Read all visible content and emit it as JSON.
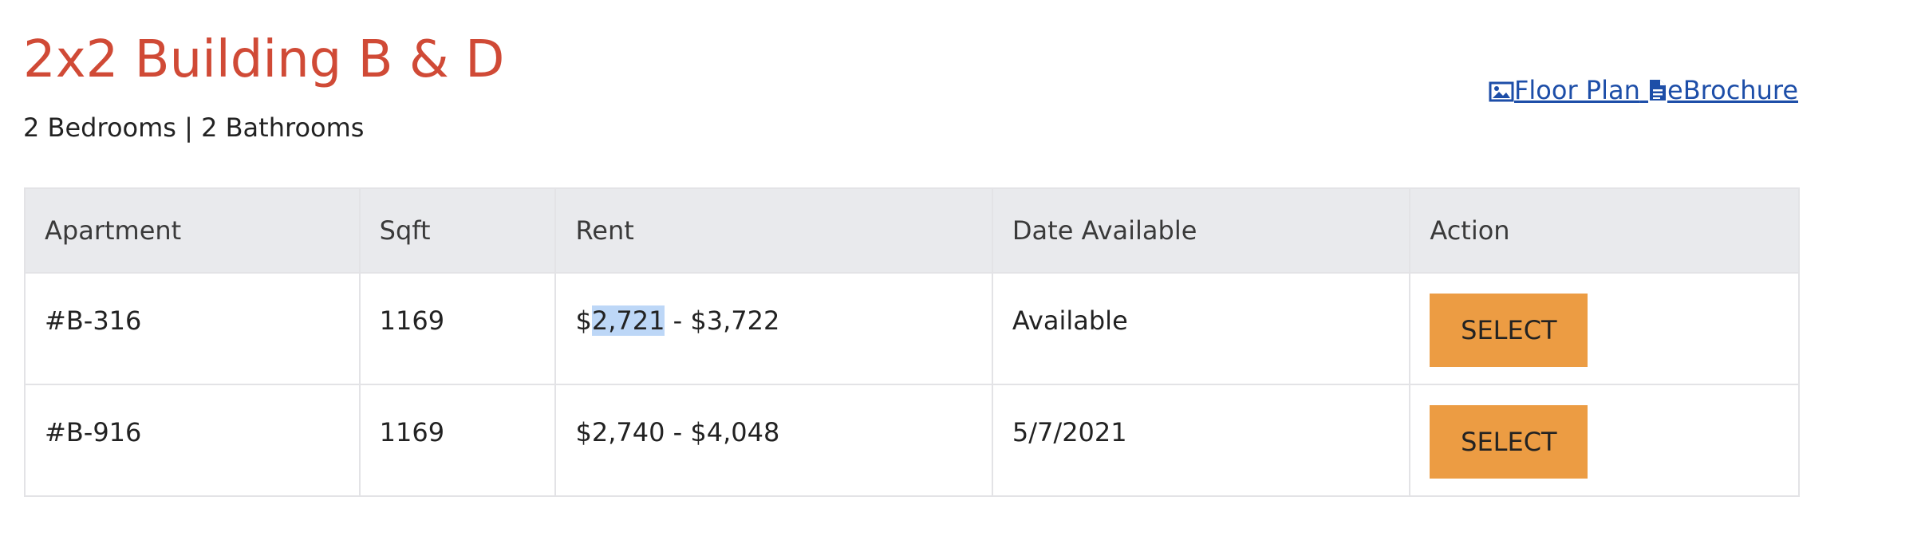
{
  "plan": {
    "title": "2x2 Building B & D",
    "details": "2 Bedrooms | 2 Bathrooms"
  },
  "links": {
    "floor_plan": "Floor Plan",
    "floor_plan_icon": "image-icon",
    "ebrochure": "eBrochure",
    "ebrochure_icon": "document-icon"
  },
  "colors": {
    "title": "#d04a36",
    "link": "#1d4ea8",
    "button": "#ec9c43",
    "header_bg": "#e9eaed",
    "selection_highlight": "#bdd7f7"
  },
  "table": {
    "headers": [
      "Apartment",
      "Sqft",
      "Rent",
      "Date Available",
      "Action"
    ],
    "rows": [
      {
        "apartment": "#B-316",
        "sqft": "1169",
        "rent_prefix": "$",
        "rent_selected": "2,721",
        "rent_suffix": " - $3,722",
        "date_available": "Available",
        "action": "SELECT"
      },
      {
        "apartment": "#B-916",
        "sqft": "1169",
        "rent": "$2,740 - $4,048",
        "date_available": "5/7/2021",
        "action": "SELECT"
      }
    ]
  }
}
